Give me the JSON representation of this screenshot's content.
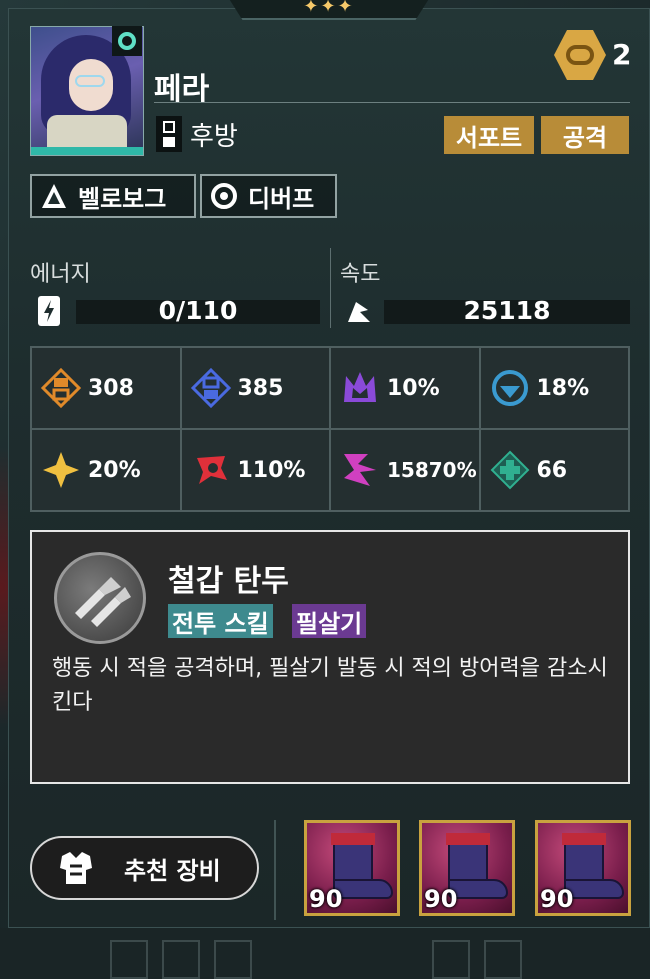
{
  "header": {
    "stars": "✦✦✦"
  },
  "character": {
    "name": "페라",
    "position": "후방",
    "tags": [
      "서포트",
      "공격"
    ],
    "currency_value": "2",
    "chips": [
      "벨로보그",
      "디버프"
    ]
  },
  "energy": {
    "label": "에너지",
    "value": "0/110",
    "fill_fraction": 0
  },
  "speed": {
    "label": "속도",
    "value": "25118"
  },
  "stats": [
    {
      "icon": "attack-stat-icon",
      "value": "308",
      "color": "#e08a2a"
    },
    {
      "icon": "defense-stat-icon",
      "value": "385",
      "color": "#4a6ae0"
    },
    {
      "icon": "crown-stat-icon",
      "value": "10%",
      "color": "#8a4ad8"
    },
    {
      "icon": "resist-stat-icon",
      "value": "18%",
      "color": "#3a9ad0"
    },
    {
      "icon": "crit-rate-icon",
      "value": "20%",
      "color": "#f0c040"
    },
    {
      "icon": "crit-damage-icon",
      "value": "110%",
      "color": "#e0303a"
    },
    {
      "icon": "power-stat-icon",
      "value": "15870%",
      "color": "#d040c0"
    },
    {
      "icon": "heal-stat-icon",
      "value": "66",
      "color": "#30b090"
    }
  ],
  "skill": {
    "name": "철갑 탄두",
    "tags": [
      "전투 스킬",
      "필살기"
    ],
    "description": "행동 시 적을 공격하며, 필살기 발동 시 적의 방어력을 감소시킨다"
  },
  "equipment": {
    "button_label": "추천 장비",
    "items": [
      {
        "level": "90"
      },
      {
        "level": "90"
      },
      {
        "level": "90"
      }
    ]
  }
}
